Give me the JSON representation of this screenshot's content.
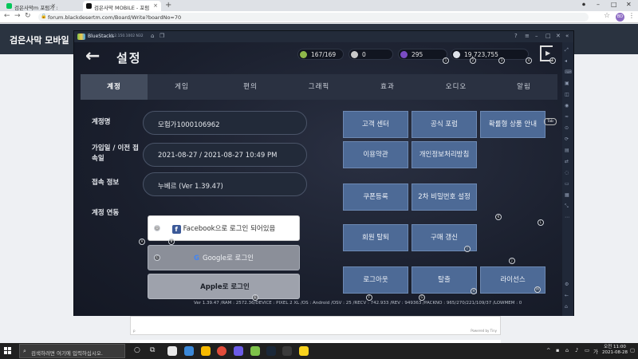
{
  "browser": {
    "tabs": [
      {
        "label": "검은사막m 포럼가 : 네이버 블로그",
        "icon": "naver-green-icon",
        "color": "#03c75a"
      },
      {
        "label": "검은사막 MOBILE - 포럼",
        "icon": "bd-mobile-icon",
        "color": "#111111"
      }
    ],
    "new_tab": "+",
    "url": "forum.blackdesertm.com/Board/Write?boardNo=70",
    "profile_initials": "BD"
  },
  "site": {
    "logo": "검은사막 모바일",
    "editor_left": "p",
    "editor_right": "Powered by Tiny",
    "side_text": "..."
  },
  "bluestacks": {
    "name": "BlueStacks",
    "version": "5.2.150.1002 N32"
  },
  "game": {
    "title": "설정",
    "resources": [
      {
        "name": "stamina",
        "value": "167/169",
        "color": "#8fb84a"
      },
      {
        "name": "silver-coin",
        "value": "0",
        "color": "#c9c9c9"
      },
      {
        "name": "black-pearl",
        "value": "295",
        "color": "#7a4cc4"
      },
      {
        "name": "silver",
        "value": "19,723,755",
        "color": "#dfe3ea"
      }
    ],
    "markers_top": [
      "1",
      "2",
      "3",
      "4",
      "5"
    ],
    "tabs": [
      "계정",
      "게임",
      "편의",
      "그래픽",
      "효과",
      "오디오",
      "알림"
    ],
    "active_tab": "계정",
    "account": {
      "name_label": "계정명",
      "name_value": "모험가1000106962",
      "join_label": "가입일 / 이전 접속일",
      "join_value": "2021-08-27 / 2021-08-27  10:49  PM",
      "conn_label": "접속 정보",
      "conn_value": "누베르 (Ver 1.39.47)",
      "link_label": "계정 연동",
      "facebook": "Facebook으로 로그인 되어있음",
      "google": "Google로 로그인",
      "apple": "Apple로 로그인"
    },
    "menu_buttons": [
      "고객 센터",
      "공식 포럼",
      "확률형 상품 안내",
      "이용약관",
      "개인정보처리방침",
      "쿠폰등록",
      "2차 비밀번호 설정",
      "회원 탈퇴",
      "구매 갱신",
      "로그아웃",
      "탈출",
      "라이선스"
    ],
    "tab_tag": "Tab",
    "markers": [
      "A",
      "B",
      "C",
      "D",
      "E",
      "F",
      "G",
      "H",
      "I",
      "J",
      "K",
      "L",
      "M",
      "N",
      "O",
      "P",
      "Q",
      "R"
    ],
    "footer": "Ver 1.39.47 /RAM : 2572.36/DEVICE : PIXEL 2 XL /OS : Android /OSV : 25 /RECV : 742.933 /REV : 949363 /PACKNO : 965/270/221/109/37 /LOWMEM : 0"
  },
  "taskbar": {
    "search_placeholder": "검색하려면 여기에 입력하십시오.",
    "time": "오전 11:00",
    "date": "2021-08-28",
    "apps": [
      "#e8e8e8",
      "#3b88d8",
      "#2c7be5",
      "#f6b900",
      "#e24c3a",
      "#6c5ce7",
      "#7ec24a",
      "#1b2838",
      "#3a3a3a",
      "#f7d21e"
    ]
  }
}
